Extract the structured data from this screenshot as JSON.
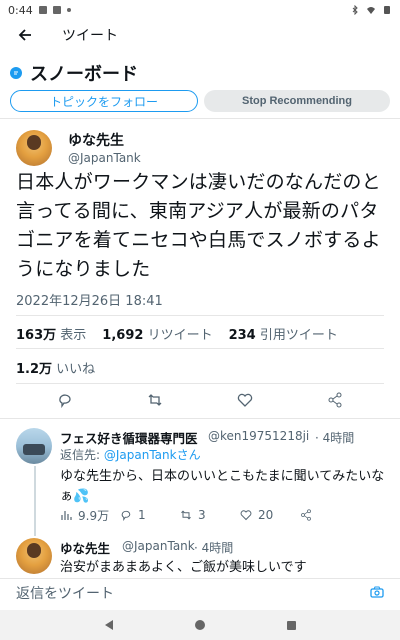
{
  "status_bar": {
    "time": "0:44"
  },
  "header": {
    "title": "ツイート"
  },
  "topic": {
    "title": "スノーボード",
    "follow_label": "トピックをフォロー",
    "stop_label": "Stop Recommending"
  },
  "tweet": {
    "name": "ゆな先生",
    "handle": "@JapanTank",
    "text": "日本人がワークマンは凄いだのなんだのと言ってる間に、東南アジア人が最新のパタゴニアを着てニセコや白馬でスノボするようになりました",
    "date": "2022年12月26日 18:41",
    "views_count": "163万",
    "views_label": "表示",
    "retweets_count": "1,692",
    "retweets_label": "リツイート",
    "quotes_count": "234",
    "quotes_label": "引用ツイート",
    "likes_count": "1.2万",
    "likes_label": "いいね"
  },
  "replies": [
    {
      "name": "フェス好き循環器専門医",
      "handle": "@ken19751218ji",
      "time": "· 4時間",
      "reply_to_prefix": "返信先: ",
      "reply_to_handle": "@JapanTankさん",
      "text": "ゆな先生から、日本のいいとこもたまに聞いてみたいなぁ💦",
      "views": "9.9万",
      "replies": "1",
      "retweets": "3",
      "likes": "20"
    },
    {
      "name": "ゆな先生",
      "handle": "@JapanTank",
      "time": "· 4時間",
      "text": "治安がまあまあよく、ご飯が美味しいです"
    }
  ],
  "compose": {
    "placeholder": "返信をツイート"
  },
  "colors": {
    "accent": "#1d9bf0",
    "text": "#0f1419",
    "muted": "#536471"
  }
}
